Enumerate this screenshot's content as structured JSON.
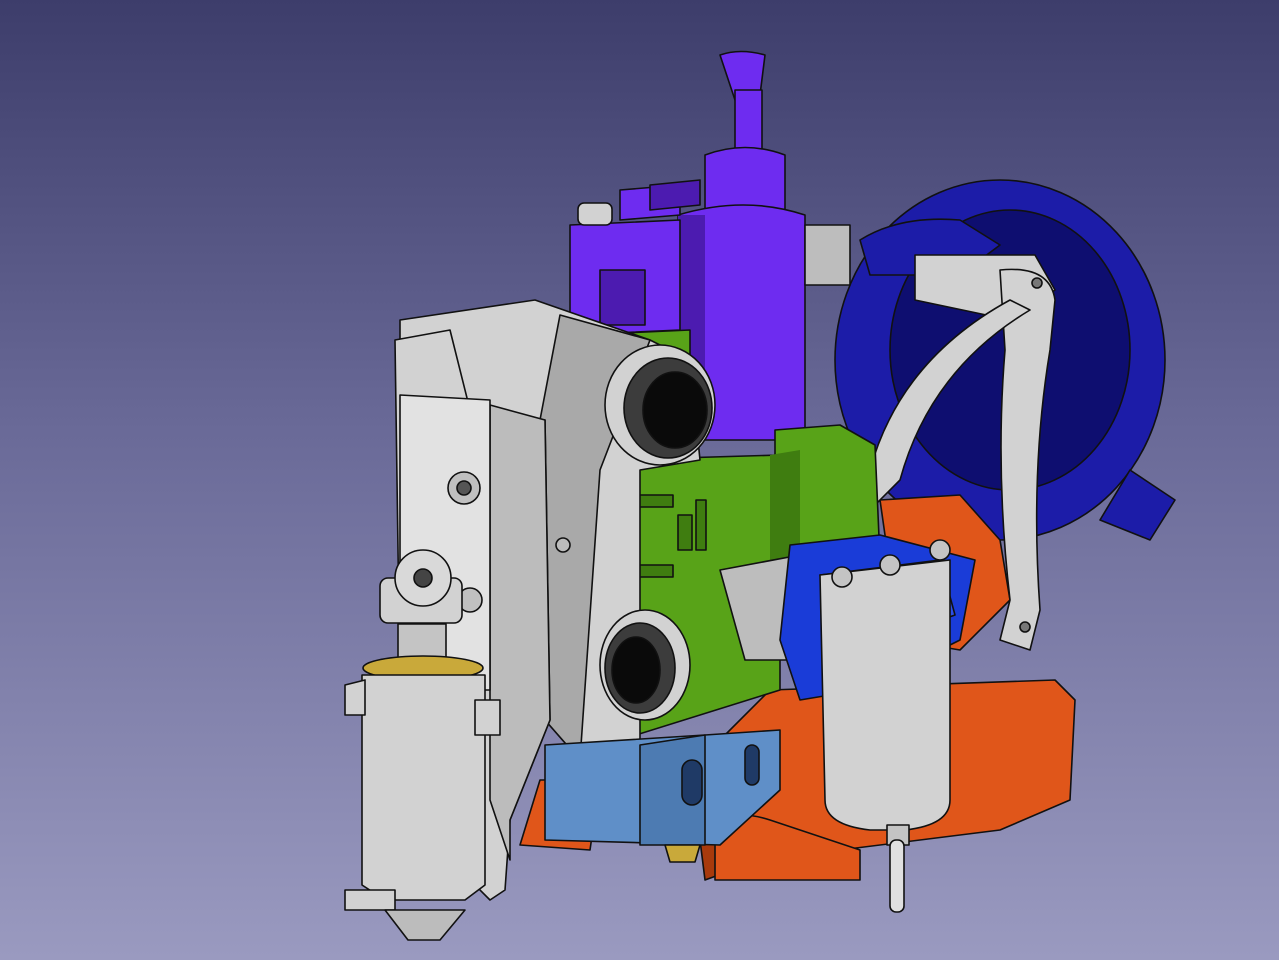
{
  "viewport": {
    "background_top": "#3d3d6b",
    "background_bottom": "#9a9ac0"
  },
  "colors": {
    "extruder_purple": "#6e2cf0",
    "extruder_purple_dark": "#4c1bb0",
    "body_green": "#58a318",
    "body_green_dark": "#3f7d10",
    "grey_part": "#d2d2d2",
    "grey_part_dark": "#a9a9a9",
    "fan_blue": "#1c1ca8",
    "fan_blue_dark": "#0e0e70",
    "duct_orange": "#e0561a",
    "duct_orange_dark": "#a83a0c",
    "heatblock_blue": "#5f8fc8",
    "probe_blue": "#1a3cd8",
    "brass": "#c9a93a"
  }
}
